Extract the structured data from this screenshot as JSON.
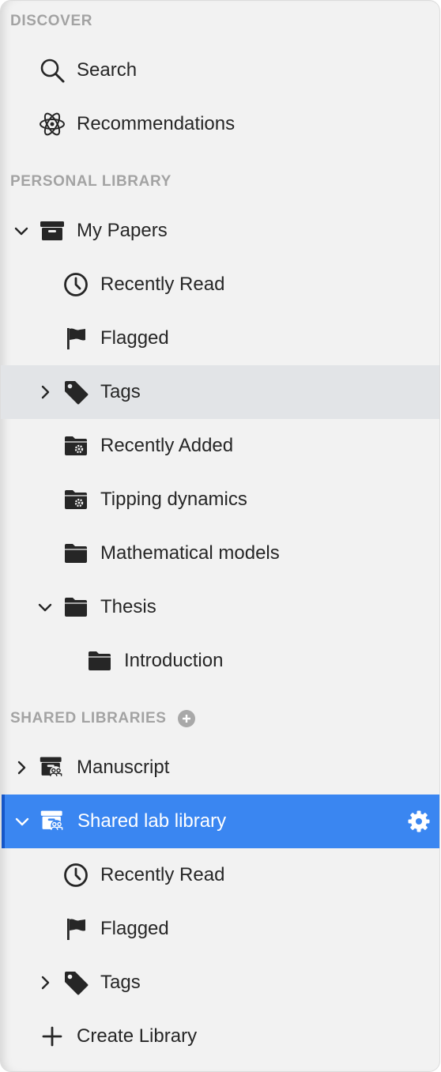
{
  "colors": {
    "accent": "#3a86f1",
    "header_text": "#a3a3a3",
    "text": "#262626",
    "background": "#f2f2f2",
    "hover": "#e2e4e7"
  },
  "sections": {
    "discover": "DISCOVER",
    "personal": "PERSONAL LIBRARY",
    "shared": "SHARED LIBRARIES"
  },
  "discover": {
    "search": {
      "label": "Search",
      "icon": "search-icon"
    },
    "recommendations": {
      "label": "Recommendations",
      "icon": "atom-icon"
    }
  },
  "personal": {
    "my_papers": {
      "label": "My Papers",
      "icon": "archive-box-icon",
      "expanded": true
    },
    "recently_read": {
      "label": "Recently Read",
      "icon": "clock-icon"
    },
    "flagged": {
      "label": "Flagged",
      "icon": "flag-icon"
    },
    "tags": {
      "label": "Tags",
      "icon": "tag-icon",
      "expanded": false,
      "hovered": true
    },
    "recently_added": {
      "label": "Recently Added",
      "icon": "smart-folder-icon"
    },
    "tipping_dynamics": {
      "label": "Tipping dynamics",
      "icon": "smart-folder-icon"
    },
    "mathematical_models": {
      "label": "Mathematical models",
      "icon": "folder-icon"
    },
    "thesis": {
      "label": "Thesis",
      "icon": "folder-icon",
      "expanded": true
    },
    "introduction": {
      "label": "Introduction",
      "icon": "folder-icon"
    }
  },
  "shared": {
    "manuscript": {
      "label": "Manuscript",
      "icon": "shared-archive-icon",
      "expanded": false
    },
    "shared_lab_library": {
      "label": "Shared lab library",
      "icon": "shared-archive-icon",
      "expanded": true,
      "selected": true
    },
    "recently_read": {
      "label": "Recently Read",
      "icon": "clock-icon"
    },
    "flagged": {
      "label": "Flagged",
      "icon": "flag-icon"
    },
    "tags": {
      "label": "Tags",
      "icon": "tag-icon",
      "expanded": false
    },
    "create_library": {
      "label": "Create Library",
      "icon": "plus-icon"
    }
  }
}
